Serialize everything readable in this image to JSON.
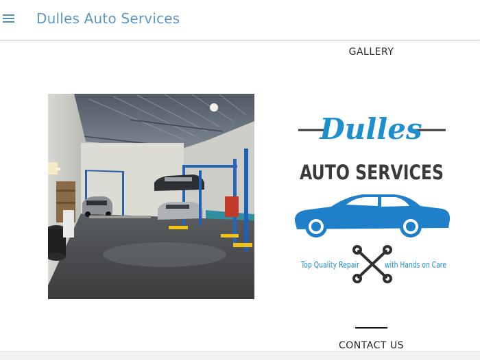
{
  "header": {
    "title": "Dulles Auto Services",
    "menu_icon": "hamburger-menu-icon",
    "accent_color": "#5a96c3"
  },
  "gallery": {
    "heading": "GALLERY",
    "images": [
      {
        "name": "auto-shop-interior-photo"
      },
      {
        "name": "dulles-auto-services-logo"
      }
    ]
  },
  "logo": {
    "script_text": "Dulles",
    "main_text": "AUTO SERVICES",
    "tagline_left": "Top Quality Repair",
    "tagline_right": "with Hands on Care",
    "script_color": "#1d8fce",
    "car_color": "#1f7fc8",
    "text_color": "#3a3a3a"
  },
  "contact": {
    "heading": "CONTACT US"
  }
}
